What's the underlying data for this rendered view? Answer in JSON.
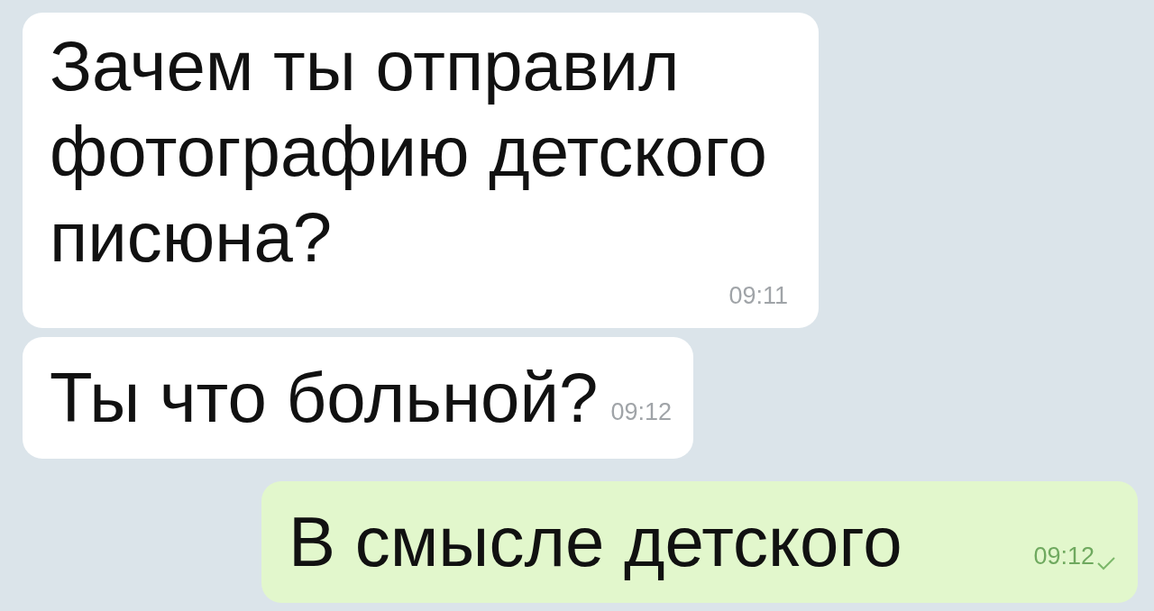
{
  "messages": [
    {
      "kind": "incoming",
      "text": "Зачем ты отправил фотографию детского писюна?",
      "time": "09:11"
    },
    {
      "kind": "incoming",
      "text": "Ты что больной?",
      "time": "09:12"
    },
    {
      "kind": "outgoing",
      "text": "В смысле детского",
      "time": "09:12",
      "delivered": true
    }
  ]
}
